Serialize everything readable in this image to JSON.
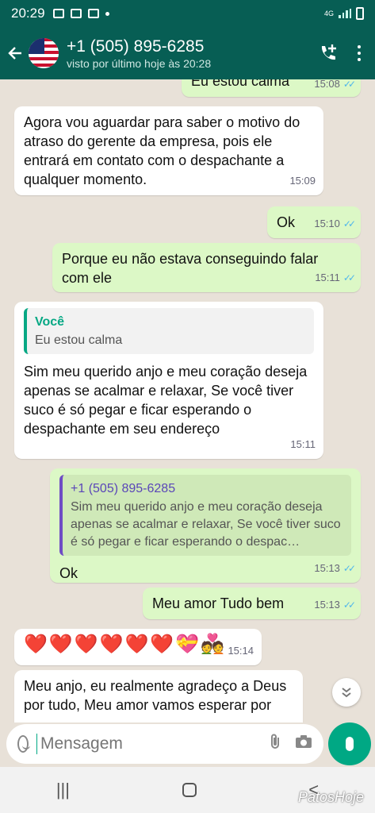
{
  "status_bar": {
    "time": "20:29",
    "network": "4G"
  },
  "header": {
    "contact_name": "+1 (505) 895-6285",
    "last_seen": "visto por último hoje às 20:28",
    "icons": [
      "back-arrow-icon",
      "add-call-icon",
      "more-vert-icon"
    ]
  },
  "messages": [
    {
      "direction": "out",
      "text": "Eu estou calma",
      "time": "15:08"
    },
    {
      "direction": "in",
      "text": "Agora vou aguardar para saber o motivo do atraso do gerente da empresa, pois ele entrará em contato com o despachante a qualquer momento.",
      "time": "15:09"
    },
    {
      "direction": "out",
      "text": "Ok",
      "time": "15:10"
    },
    {
      "direction": "out",
      "text": "Porque eu não  estava conseguindo falar com ele",
      "time": "15:11"
    },
    {
      "direction": "in",
      "reply_to": {
        "author": "Você",
        "text": "Eu estou calma"
      },
      "text": "Sim meu querido anjo e meu coração deseja apenas se acalmar e relaxar, Se você tiver suco é só pegar e ficar esperando o despachante em seu endereço",
      "time": "15:11"
    },
    {
      "direction": "out",
      "reply_to": {
        "author": "+1 (505) 895-6285",
        "text": "Sim meu querido anjo e meu coração deseja apenas se acalmar e relaxar, Se você tiver suco é só pegar e ficar esperando o despac…"
      },
      "text": "Ok",
      "time": "15:13"
    },
    {
      "direction": "out",
      "text": "Meu amor Tudo bem",
      "time": "15:13"
    },
    {
      "direction": "in",
      "text": "❤️❤️❤️❤️❤️❤️💝💑",
      "time": "15:14"
    },
    {
      "direction": "in",
      "text": "Meu anjo, eu realmente agradeço a Deus por tudo, Meu amor vamos esperar por"
    }
  ],
  "composer": {
    "placeholder": "Mensagem"
  },
  "watermark": "PatosHoje",
  "colors": {
    "header": "#075e54",
    "outgoing_bubble": "#dcf8c6",
    "accent": "#00a884",
    "read_ticks": "#4fb6ec"
  }
}
